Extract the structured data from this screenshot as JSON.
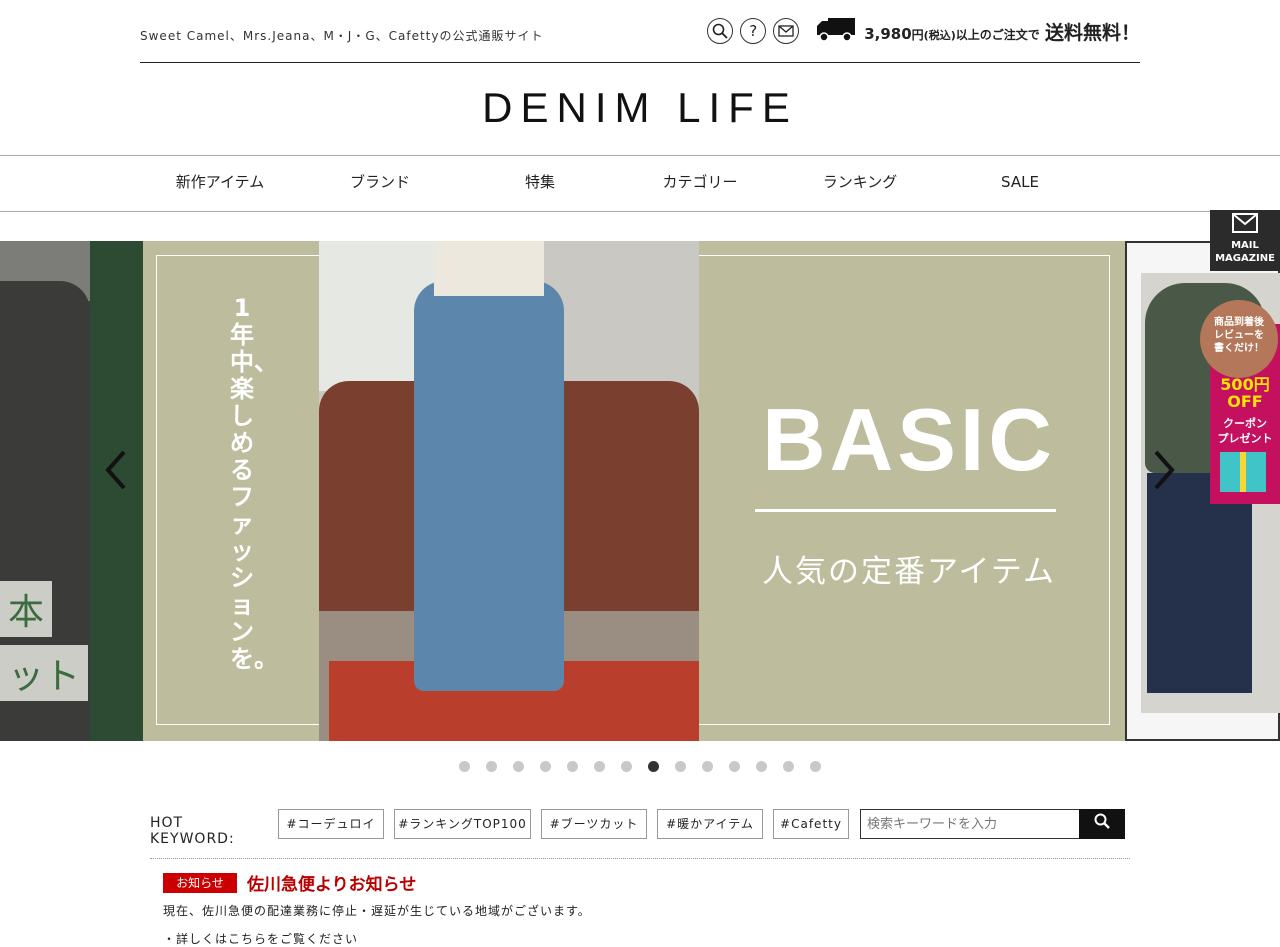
{
  "header": {
    "tagline": "Sweet Camel、Mrs.Jeana、M・J・G、Cafettyの公式通販サイト",
    "shipping_amount": "3,980",
    "shipping_yen": "円",
    "shipping_tax": "(税込)",
    "shipping_mid": "以上のご注文で",
    "shipping_free": "送料無料！",
    "logo": "DENIM LIFE"
  },
  "nav": {
    "items": [
      {
        "label": "新作アイテム"
      },
      {
        "label": "ブランド"
      },
      {
        "label": "特集"
      },
      {
        "label": "カテゴリー"
      },
      {
        "label": "ランキング"
      },
      {
        "label": "SALE"
      }
    ]
  },
  "slider": {
    "left_tag1": "本",
    "left_tag2": "ット",
    "vertical_text": "1年中、楽しめるファッションを。",
    "headline": "BASIC",
    "subheadline": "人気の定番アイテム",
    "dot_count": 14,
    "active_index": 7
  },
  "side": {
    "mail_line1": "MAIL",
    "mail_line2": "MAGAZINE",
    "coupon_circle": "商品到着後\nレビューを\n書くだけ！",
    "coupon_amount": "500円",
    "coupon_off": "OFF",
    "coupon_text1": "クーポン",
    "coupon_text2": "プレゼント"
  },
  "keywords": {
    "label": "HOT KEYWORD:",
    "tags": [
      "#コーデュロイ",
      "#ランキングTOP100",
      "#ブーツカット",
      "#暖かアイテム",
      "#Cafetty"
    ]
  },
  "search": {
    "placeholder": "検索キーワードを入力"
  },
  "notice": {
    "badge": "お知らせ",
    "title": "佐川急便よりお知らせ",
    "body": "現在、佐川急便の配達業務に停止・遅延が生じている地域がございます。",
    "more": "・詳しくはこちらをご覧ください"
  },
  "colors": {
    "accent": "#c00000",
    "slide_bg": "#bdbc9c",
    "coupon_bg": "#c4105e"
  }
}
